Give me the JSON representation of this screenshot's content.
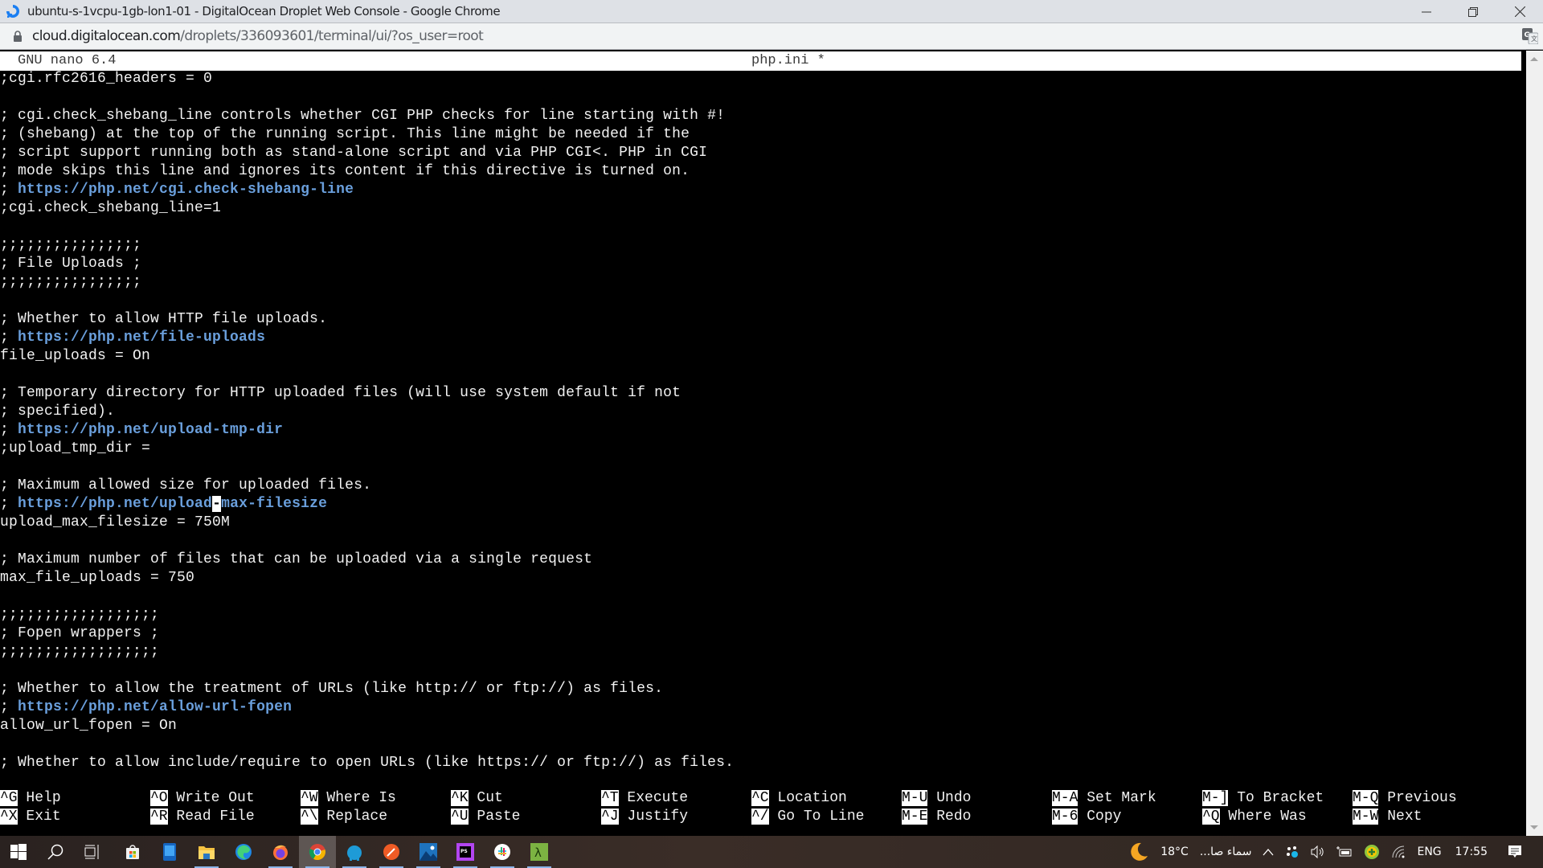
{
  "browser": {
    "window_title": "ubuntu-s-1vcpu-1gb-lon1-01 - DigitalOcean Droplet Web Console - Google Chrome",
    "url_host": "cloud.digitalocean.com",
    "url_path": "/droplets/336093601/terminal/ui/?os_user=root",
    "icons": {
      "app": "digitalocean-logo-icon",
      "lock": "lock-icon",
      "translate": "translate-icon",
      "minimize": "minimize-icon",
      "restore": "restore-icon",
      "close": "close-icon"
    }
  },
  "nano": {
    "version": "GNU nano 6.4",
    "filename": "php.ini *",
    "lines": [
      {
        "text": ";cgi.rfc2616_headers = 0"
      },
      {
        "text": ""
      },
      {
        "text": "; cgi.check_shebang_line controls whether CGI PHP checks for line starting with #!"
      },
      {
        "text": "; (shebang) at the top of the running script. This line might be needed if the"
      },
      {
        "text": "; script support running both as stand-alone script and via PHP CGI<. PHP in CGI"
      },
      {
        "text": "; mode skips this line and ignores its content if this directive is turned on."
      },
      {
        "prefix": "; ",
        "link": "https://php.net/cgi.check-shebang-line"
      },
      {
        "text": ";cgi.check_shebang_line=1"
      },
      {
        "text": ""
      },
      {
        "text": ";;;;;;;;;;;;;;;;"
      },
      {
        "text": "; File Uploads ;"
      },
      {
        "text": ";;;;;;;;;;;;;;;;"
      },
      {
        "text": ""
      },
      {
        "text": "; Whether to allow HTTP file uploads."
      },
      {
        "prefix": "; ",
        "link": "https://php.net/file-uploads"
      },
      {
        "text": "file_uploads = On"
      },
      {
        "text": ""
      },
      {
        "text": "; Temporary directory for HTTP uploaded files (will use system default if not"
      },
      {
        "text": "; specified)."
      },
      {
        "prefix": "; ",
        "link": "https://php.net/upload-tmp-dir"
      },
      {
        "text": ";upload_tmp_dir ="
      },
      {
        "text": ""
      },
      {
        "text": "; Maximum allowed size for uploaded files."
      },
      {
        "prefix": "; ",
        "link_before": "https://php.net/upload",
        "cursor_char": "-",
        "link_after": "max-filesize"
      },
      {
        "text": "upload_max_filesize = 750M"
      },
      {
        "text": ""
      },
      {
        "text": "; Maximum number of files that can be uploaded via a single request"
      },
      {
        "text": "max_file_uploads = 750"
      },
      {
        "text": ""
      },
      {
        "text": ";;;;;;;;;;;;;;;;;;"
      },
      {
        "text": "; Fopen wrappers ;"
      },
      {
        "text": ";;;;;;;;;;;;;;;;;;"
      },
      {
        "text": ""
      },
      {
        "text": "; Whether to allow the treatment of URLs (like http:// or ftp://) as files."
      },
      {
        "prefix": "; ",
        "link": "https://php.net/allow-url-fopen"
      },
      {
        "text": "allow_url_fopen = On"
      },
      {
        "text": ""
      },
      {
        "text": "; Whether to allow include/require to open URLs (like https:// or ftp://) as files."
      }
    ],
    "shortcuts": [
      [
        {
          "key": "^G",
          "label": "Help"
        },
        {
          "key": "^O",
          "label": "Write Out"
        },
        {
          "key": "^W",
          "label": "Where Is"
        },
        {
          "key": "^K",
          "label": "Cut"
        },
        {
          "key": "^T",
          "label": "Execute"
        },
        {
          "key": "^C",
          "label": "Location"
        },
        {
          "key": "M-U",
          "label": "Undo"
        },
        {
          "key": "M-A",
          "label": "Set Mark"
        },
        {
          "key": "M-]",
          "label": "To Bracket"
        },
        {
          "key": "M-Q",
          "label": "Previous"
        }
      ],
      [
        {
          "key": "^X",
          "label": "Exit"
        },
        {
          "key": "^R",
          "label": "Read File"
        },
        {
          "key": "^\\",
          "label": "Replace"
        },
        {
          "key": "^U",
          "label": "Paste"
        },
        {
          "key": "^J",
          "label": "Justify"
        },
        {
          "key": "^/",
          "label": "Go To Line"
        },
        {
          "key": "M-E",
          "label": "Redo"
        },
        {
          "key": "M-6",
          "label": "Copy"
        },
        {
          "key": "^Q",
          "label": "Where Was"
        },
        {
          "key": "M-W",
          "label": "Next"
        }
      ]
    ]
  },
  "taskbar": {
    "apps": [
      {
        "name": "start-icon",
        "running": false,
        "active": false
      },
      {
        "name": "search-icon",
        "running": false,
        "active": false
      },
      {
        "name": "task-view-icon",
        "running": false,
        "active": false
      },
      {
        "name": "microsoft-store-icon",
        "running": false,
        "active": false
      },
      {
        "name": "tablet-app-icon",
        "running": false,
        "active": false
      },
      {
        "name": "file-explorer-icon",
        "running": true,
        "active": false
      },
      {
        "name": "edge-icon",
        "running": false,
        "active": false
      },
      {
        "name": "firefox-icon",
        "running": true,
        "active": false
      },
      {
        "name": "chrome-icon",
        "running": true,
        "active": true
      },
      {
        "name": "mysql-workbench-icon",
        "running": true,
        "active": false
      },
      {
        "name": "postman-icon",
        "running": true,
        "active": false
      },
      {
        "name": "photos-icon",
        "running": true,
        "active": false
      },
      {
        "name": "phpstorm-icon",
        "running": true,
        "active": false
      },
      {
        "name": "slack-icon",
        "running": true,
        "active": false
      },
      {
        "name": "lambda-app-icon",
        "running": true,
        "active": false
      }
    ],
    "tray": {
      "temperature": "18°C",
      "weather_text": "سماء صا...",
      "language": "ENG",
      "time": "17:55"
    }
  },
  "colors": {
    "terminal_bg": "#000000",
    "terminal_fg": "#f2f2f2",
    "link": "#6a9fdc",
    "titlebar_bg": "#dee1e6",
    "urlbar_bg": "#f1f3f4"
  }
}
